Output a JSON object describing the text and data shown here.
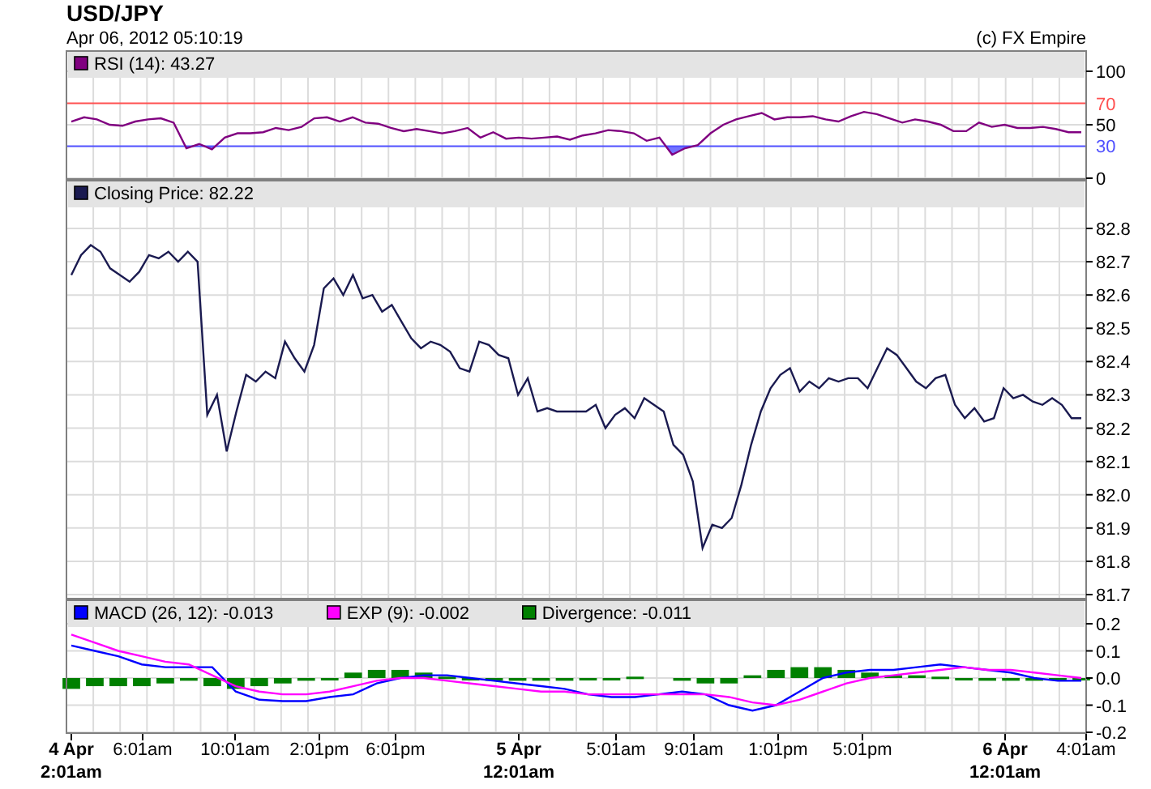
{
  "header": {
    "title": "USD/JPY",
    "timestamp": "Apr 06, 2012 05:10:19",
    "credit": "(c) FX Empire"
  },
  "panels": [
    {
      "chart_data": {
        "type": "line",
        "grid": true,
        "ylim": [
          0,
          100
        ],
        "yticks": [
          0,
          50,
          100
        ],
        "legend": "top left",
        "ref_lines": [
          {
            "axis": "y",
            "value": 70,
            "color": "#ff5050",
            "label": "70"
          },
          {
            "axis": "y",
            "value": 30,
            "color": "#5050ff",
            "label": "30"
          }
        ],
        "series": [
          {
            "name": "RSI (14): 43.27",
            "color": "#800080",
            "type": "line",
            "values": [
              53,
              57,
              55,
              50,
              49,
              53,
              55,
              56,
              52,
              28,
              32,
              27,
              38,
              42,
              42,
              43,
              47,
              45,
              48,
              56,
              57,
              53,
              57,
              52,
              51,
              47,
              44,
              46,
              44,
              42,
              44,
              47,
              38,
              43,
              37,
              38,
              37,
              38,
              39,
              36,
              40,
              42,
              45,
              44,
              42,
              35,
              38,
              22,
              28,
              31,
              42,
              50,
              55,
              58,
              61,
              55,
              57,
              57,
              58,
              55,
              53,
              58,
              62,
              60,
              56,
              52,
              55,
              53,
              50,
              44,
              44,
              52,
              48,
              50,
              47,
              47,
              48,
              46,
              43,
              43
            ]
          }
        ]
      }
    },
    {
      "chart_data": {
        "type": "line",
        "grid": true,
        "legend": "top left",
        "ylim": [
          81.7,
          82.8
        ],
        "yticks": [
          {
            "value": 81.7,
            "label": "81.7"
          },
          {
            "value": 81.8,
            "label": "81.8"
          },
          {
            "value": 81.9,
            "label": "81.9"
          },
          {
            "value": 82.0,
            "label": "82.0"
          },
          {
            "value": 82.1,
            "label": "82.1"
          },
          {
            "value": 82.2,
            "label": "82.2"
          },
          {
            "value": 82.3,
            "label": "82.3"
          },
          {
            "value": 82.4,
            "label": "82.4"
          },
          {
            "value": 82.5,
            "label": "82.5"
          },
          {
            "value": 82.6,
            "label": "82.6"
          },
          {
            "value": 82.7,
            "label": "82.7"
          },
          {
            "value": 82.8,
            "label": "82.8"
          }
        ],
        "series": [
          {
            "name": "Closing Price: 82.22",
            "color": "#1a1a50",
            "type": "line",
            "values": [
              82.66,
              82.72,
              82.75,
              82.73,
              82.68,
              82.66,
              82.64,
              82.67,
              82.72,
              82.71,
              82.73,
              82.7,
              82.73,
              82.7,
              82.24,
              82.3,
              82.13,
              82.25,
              82.36,
              82.34,
              82.37,
              82.35,
              82.46,
              82.41,
              82.37,
              82.45,
              82.62,
              82.65,
              82.6,
              82.66,
              82.59,
              82.6,
              82.55,
              82.57,
              82.52,
              82.47,
              82.44,
              82.46,
              82.45,
              82.43,
              82.38,
              82.37,
              82.46,
              82.45,
              82.42,
              82.41,
              82.3,
              82.35,
              82.25,
              82.26,
              82.25,
              82.25,
              82.25,
              82.25,
              82.27,
              82.2,
              82.24,
              82.26,
              82.23,
              82.29,
              82.27,
              82.25,
              82.15,
              82.12,
              82.04,
              81.84,
              81.91,
              81.9,
              81.93,
              82.03,
              82.15,
              82.25,
              82.32,
              82.36,
              82.38,
              82.31,
              82.34,
              82.32,
              82.35,
              82.34,
              82.35,
              82.35,
              82.32,
              82.38,
              82.44,
              82.42,
              82.38,
              82.34,
              82.32,
              82.35,
              82.36,
              82.27,
              82.23,
              82.26,
              82.22,
              82.23,
              82.32,
              82.29,
              82.3,
              82.28,
              82.27,
              82.29,
              82.27,
              82.23,
              82.23
            ]
          }
        ]
      }
    },
    {
      "chart_data": {
        "type": "line",
        "grid": true,
        "legend": "top left",
        "ylim": [
          -0.2,
          0.2
        ],
        "yticks": [
          {
            "value": -0.2,
            "label": "-0.2"
          },
          {
            "value": -0.1,
            "label": "-0.1"
          },
          {
            "value": 0,
            "label": "0.0"
          },
          {
            "value": 0.1,
            "label": "0.1"
          },
          {
            "value": 0.2,
            "label": "0.2"
          }
        ],
        "series": [
          {
            "name": "MACD (26, 12): -0.013",
            "color": "#0000ff",
            "type": "line",
            "values": [
              0.12,
              0.1,
              0.08,
              0.05,
              0.04,
              0.04,
              0.04,
              -0.05,
              -0.08,
              -0.085,
              -0.085,
              -0.07,
              -0.06,
              -0.02,
              0.0,
              0.01,
              0.01,
              0.0,
              -0.01,
              -0.02,
              -0.03,
              -0.04,
              -0.06,
              -0.07,
              -0.07,
              -0.06,
              -0.05,
              -0.06,
              -0.1,
              -0.12,
              -0.1,
              -0.05,
              0.0,
              0.02,
              0.03,
              0.03,
              0.04,
              0.05,
              0.04,
              0.03,
              0.02,
              0.0,
              -0.01,
              -0.01
            ]
          },
          {
            "name": "EXP (9): -0.002",
            "color": "#ff00ff",
            "type": "line",
            "values": [
              0.16,
              0.13,
              0.1,
              0.08,
              0.06,
              0.05,
              0.01,
              -0.03,
              -0.05,
              -0.06,
              -0.06,
              -0.05,
              -0.03,
              -0.01,
              0.0,
              0.0,
              -0.01,
              -0.02,
              -0.03,
              -0.04,
              -0.05,
              -0.05,
              -0.06,
              -0.06,
              -0.06,
              -0.06,
              -0.06,
              -0.06,
              -0.07,
              -0.09,
              -0.1,
              -0.08,
              -0.05,
              -0.02,
              0.0,
              0.01,
              0.02,
              0.03,
              0.04,
              0.03,
              0.03,
              0.02,
              0.01,
              0.0
            ]
          },
          {
            "name": "Divergence: -0.011",
            "color": "#008000",
            "type": "bar",
            "values": [
              -0.04,
              -0.03,
              -0.03,
              -0.03,
              -0.02,
              -0.01,
              -0.03,
              -0.04,
              -0.03,
              -0.02,
              -0.01,
              -0.005,
              0.02,
              0.03,
              0.03,
              0.02,
              0.005,
              -0.005,
              -0.01,
              -0.01,
              -0.01,
              -0.01,
              -0.005,
              -0.005,
              0.005,
              null,
              -0.01,
              -0.02,
              -0.02,
              0.01,
              0.03,
              0.04,
              0.04,
              0.03,
              0.02,
              0.01,
              0.01,
              0.005,
              -0.005,
              -0.01,
              -0.01,
              -0.01,
              -0.005,
              -0.005
            ]
          }
        ]
      }
    }
  ],
  "time_axis": {
    "ticks": [
      {
        "lines": [
          "4 Apr",
          "2:01am"
        ]
      },
      {
        "lines": [
          "6:01am"
        ]
      },
      {
        "lines": [
          "10:01am"
        ]
      },
      {
        "lines": [
          "2:01pm"
        ]
      },
      {
        "lines": [
          "6:01pm"
        ]
      },
      {
        "lines": [
          "5 Apr",
          "12:01am"
        ]
      },
      {
        "lines": [
          "5:01am"
        ]
      },
      {
        "lines": [
          "9:01am"
        ]
      },
      {
        "lines": [
          "1:01pm"
        ]
      },
      {
        "lines": [
          "5:01pm"
        ]
      },
      {
        "lines": [
          "6 Apr",
          "12:01am"
        ]
      },
      {
        "lines": [
          "4:01am"
        ]
      }
    ]
  }
}
